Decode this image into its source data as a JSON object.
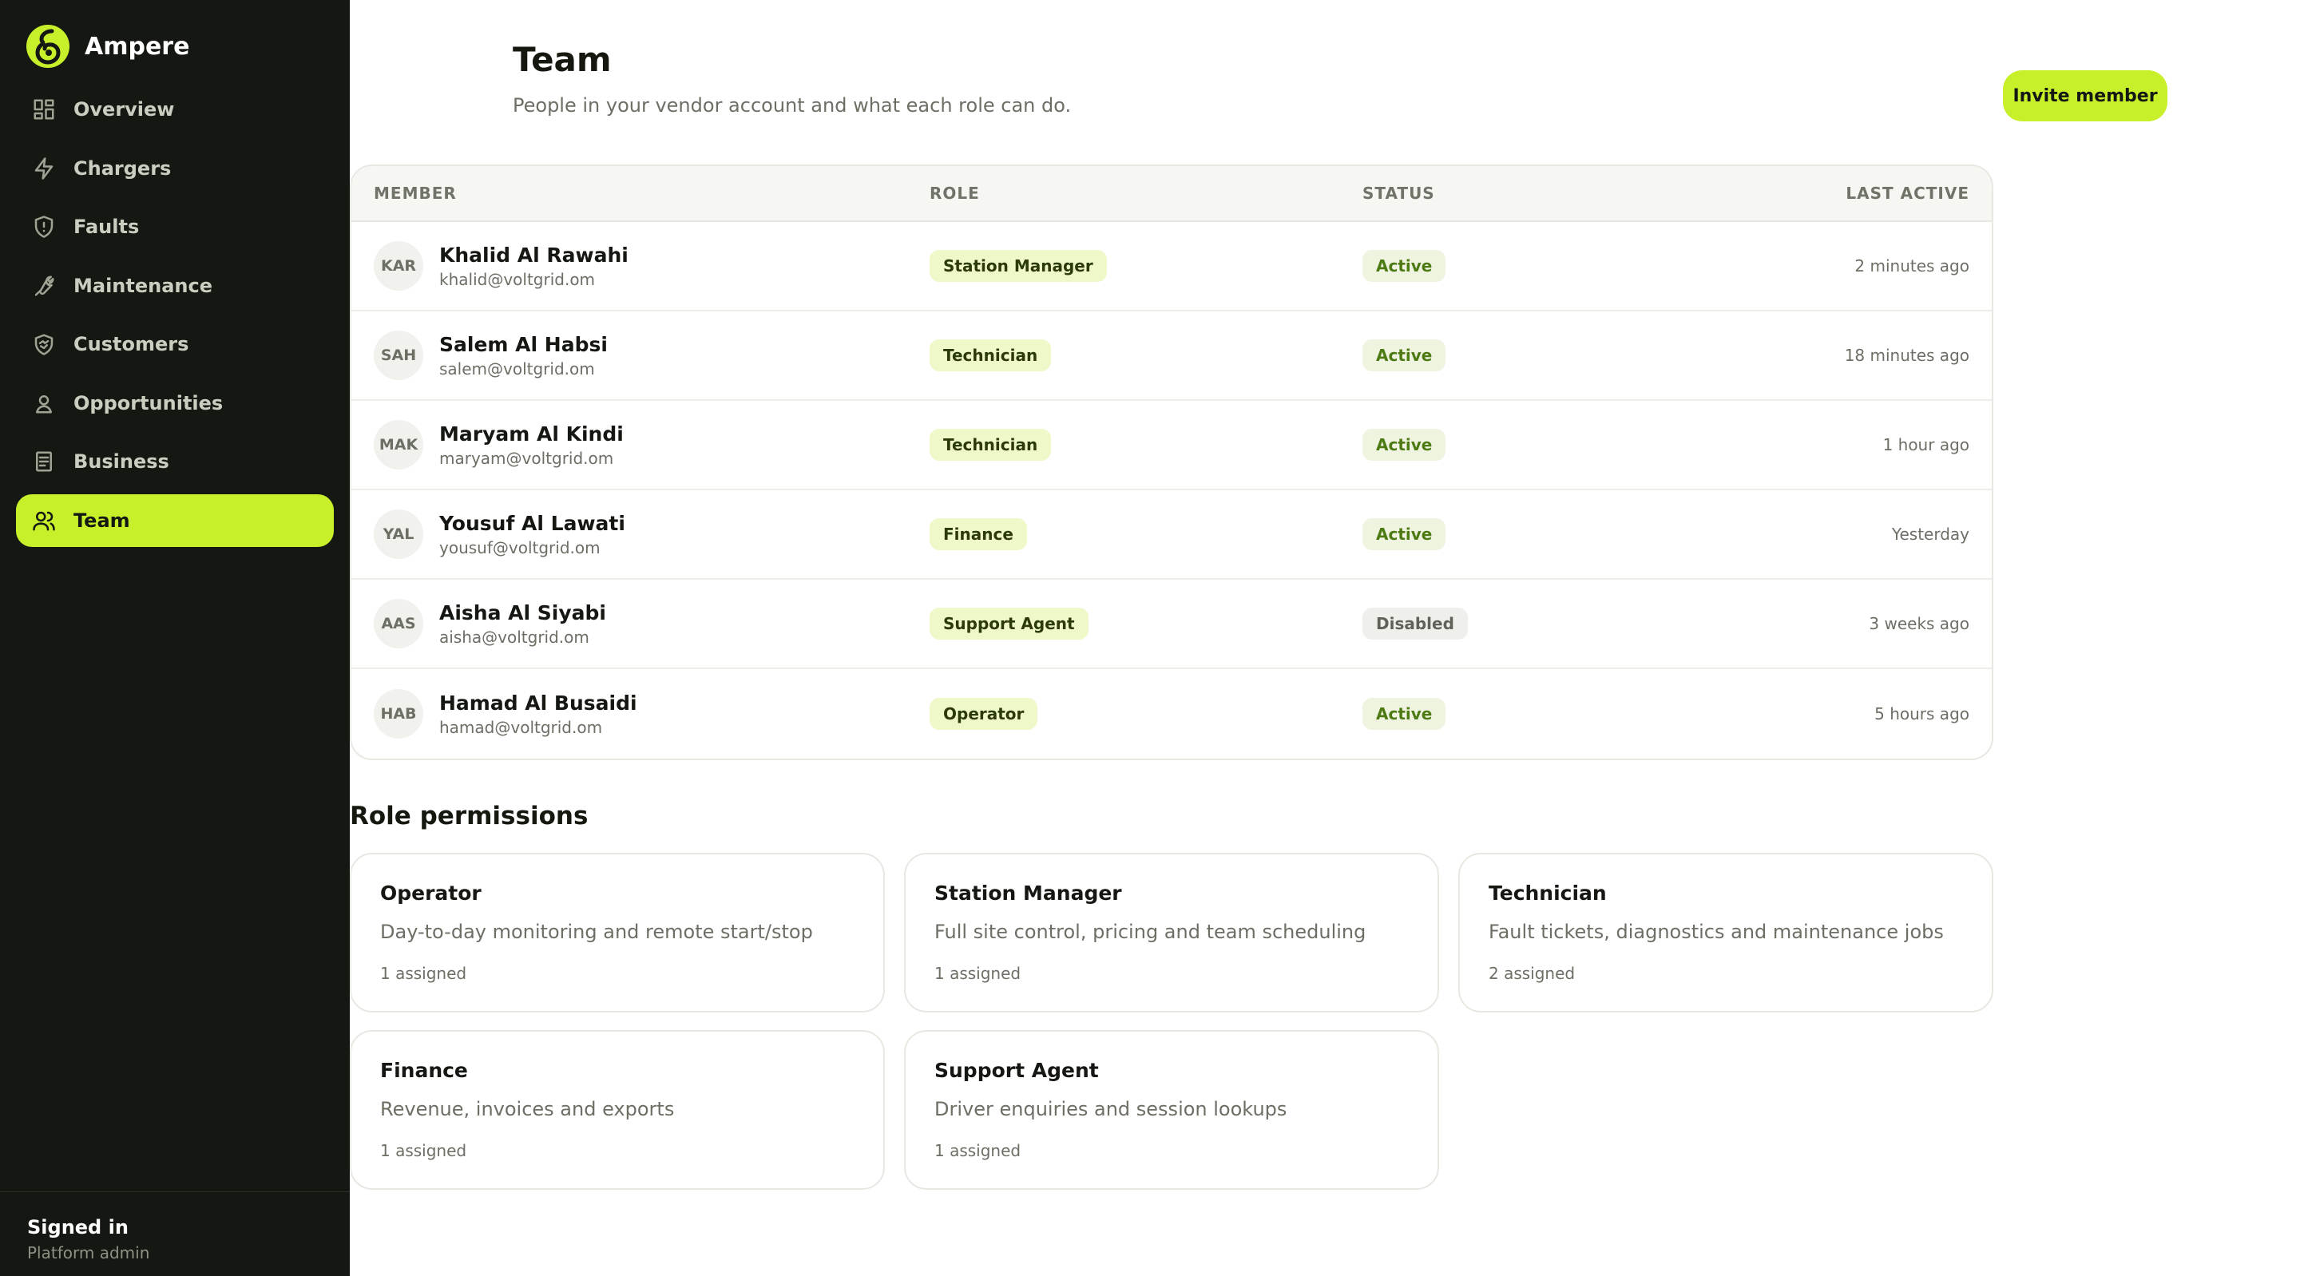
{
  "app": {
    "name": "Ampere"
  },
  "nav": [
    {
      "label": "Overview",
      "icon": "grid-icon",
      "active": false
    },
    {
      "label": "Chargers",
      "icon": "bolt-icon",
      "active": false
    },
    {
      "label": "Faults",
      "icon": "shield-alert-icon",
      "active": false
    },
    {
      "label": "Maintenance",
      "icon": "wrench-icon",
      "active": false
    },
    {
      "label": "Customers",
      "icon": "handshake-icon",
      "active": false
    },
    {
      "label": "Opportunities",
      "icon": "user-badge-icon",
      "active": false
    },
    {
      "label": "Business",
      "icon": "document-icon",
      "active": false
    },
    {
      "label": "Team",
      "icon": "users-icon",
      "active": true
    }
  ],
  "signed_in": {
    "title": "Signed in",
    "role": "Platform admin"
  },
  "header": {
    "title": "Team",
    "subtitle": "People in your vendor account and what each role can do.",
    "invite_label": "Invite member"
  },
  "table": {
    "columns": [
      "MEMBER",
      "ROLE",
      "STATUS",
      "LAST ACTIVE"
    ],
    "rows": [
      {
        "initials": "KAR",
        "name": "Khalid Al Rawahi",
        "email": "khalid@voltgrid.om",
        "role": "Station Manager",
        "status": "Active",
        "last_active": "2 minutes ago"
      },
      {
        "initials": "SAH",
        "name": "Salem Al Habsi",
        "email": "salem@voltgrid.om",
        "role": "Technician",
        "status": "Active",
        "last_active": "18 minutes ago"
      },
      {
        "initials": "MAK",
        "name": "Maryam Al Kindi",
        "email": "maryam@voltgrid.om",
        "role": "Technician",
        "status": "Active",
        "last_active": "1 hour ago"
      },
      {
        "initials": "YAL",
        "name": "Yousuf Al Lawati",
        "email": "yousuf@voltgrid.om",
        "role": "Finance",
        "status": "Active",
        "last_active": "Yesterday"
      },
      {
        "initials": "AAS",
        "name": "Aisha Al Siyabi",
        "email": "aisha@voltgrid.om",
        "role": "Support Agent",
        "status": "Disabled",
        "last_active": "3 weeks ago"
      },
      {
        "initials": "HAB",
        "name": "Hamad Al Busaidi",
        "email": "hamad@voltgrid.om",
        "role": "Operator",
        "status": "Active",
        "last_active": "5 hours ago"
      }
    ]
  },
  "permissions": {
    "title": "Role permissions",
    "roles": [
      {
        "name": "Operator",
        "description": "Day-to-day monitoring and remote start/stop",
        "assigned": "1 assigned"
      },
      {
        "name": "Station Manager",
        "description": "Full site control, pricing and team scheduling",
        "assigned": "1 assigned"
      },
      {
        "name": "Technician",
        "description": "Fault tickets, diagnostics and maintenance jobs",
        "assigned": "2 assigned"
      },
      {
        "name": "Finance",
        "description": "Revenue, invoices and exports",
        "assigned": "1 assigned"
      },
      {
        "name": "Support Agent",
        "description": "Driver enquiries and session lookups",
        "assigned": "1 assigned"
      }
    ]
  },
  "colors": {
    "accent": "#c8f02a",
    "sidebar": "#151812",
    "active_status": "#4d7a12"
  }
}
